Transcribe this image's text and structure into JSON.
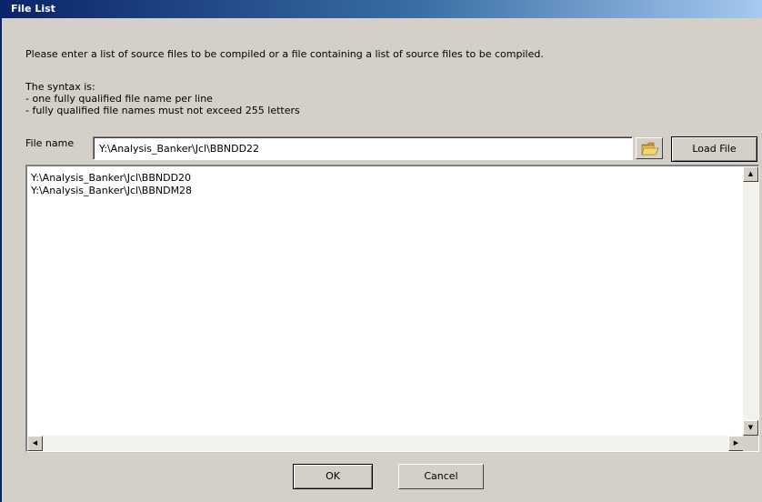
{
  "window": {
    "title": "File List"
  },
  "instructions": "Please enter a list of source files to be compiled or a file containing a list of source files to be compiled.",
  "syntax": [
    "The syntax is:",
    "- one fully qualified file name per line",
    "- fully qualified file names must not exceed 255 letters"
  ],
  "file_name": {
    "label": "File name",
    "value": "Y:\\Analysis_Banker\\Jcl\\BBNDD22"
  },
  "browse_icon": "folder-open-icon",
  "load_file_label": "Load File",
  "file_list": [
    "Y:\\Analysis_Banker\\Jcl\\BBNDD20",
    "Y:\\Analysis_Banker\\Jcl\\BBNDM28"
  ],
  "buttons": {
    "ok": "OK",
    "cancel": "Cancel"
  },
  "colors": {
    "title_bar": "#0a246a",
    "dialog_bg": "#d4d0c8",
    "folder": "#e8b83a"
  }
}
